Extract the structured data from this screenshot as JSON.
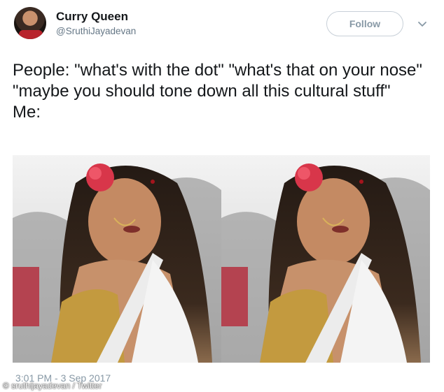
{
  "user": {
    "display_name": "Curry Queen",
    "handle": "@SruthiJayadevan"
  },
  "follow_button": {
    "label": "Follow"
  },
  "menu": {
    "icon": "chevron-down-icon"
  },
  "tweet": {
    "text": "People: \"what's with the dot\" \"what's that on your nose\" \"maybe you should tone down all this cultural stuff\"\nMe:",
    "timestamp": "3:01 PM - 3 Sep 2017"
  },
  "credit": "© sruthijayadevan / Twitter",
  "colors": {
    "text": "#14171a",
    "muted": "#657786",
    "follow_border": "#c8d0d8",
    "follow_text": "#8899a6"
  }
}
